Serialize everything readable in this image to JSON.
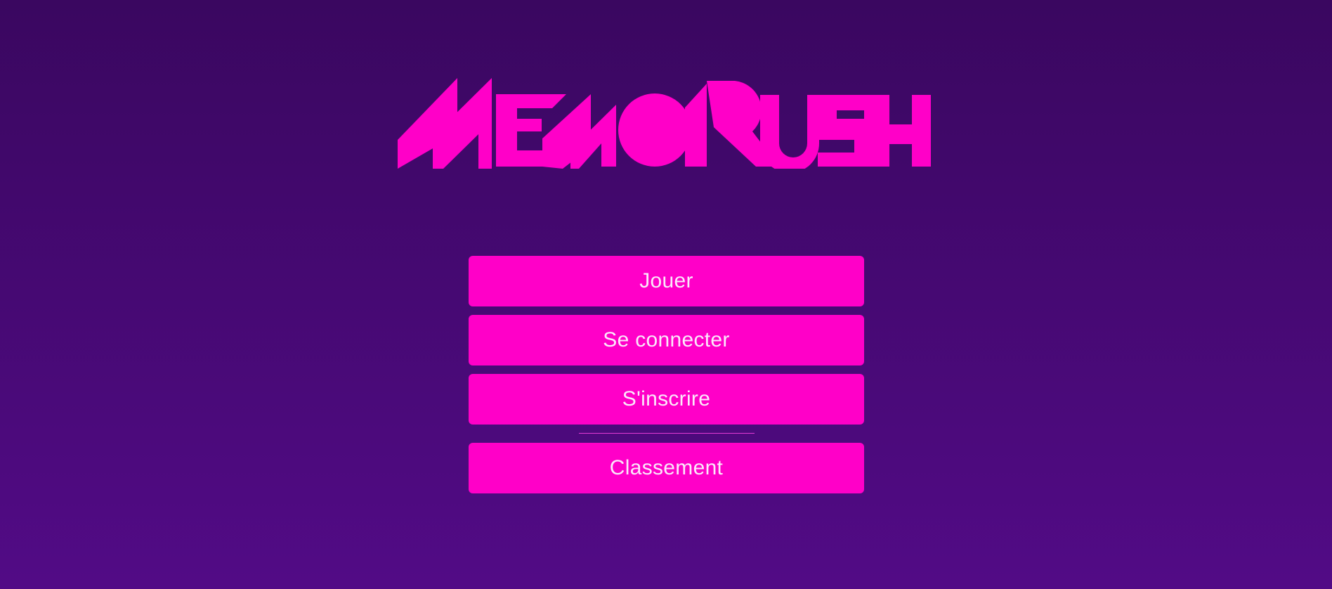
{
  "app": {
    "logo_text": "MEMORUSH",
    "accent_color": "#ff00c8",
    "background_top": "#3a0760",
    "background_bottom": "#520b86"
  },
  "menu": {
    "play_label": "Jouer",
    "login_label": "Se connecter",
    "register_label": "S'inscrire",
    "leaderboard_label": "Classement"
  }
}
